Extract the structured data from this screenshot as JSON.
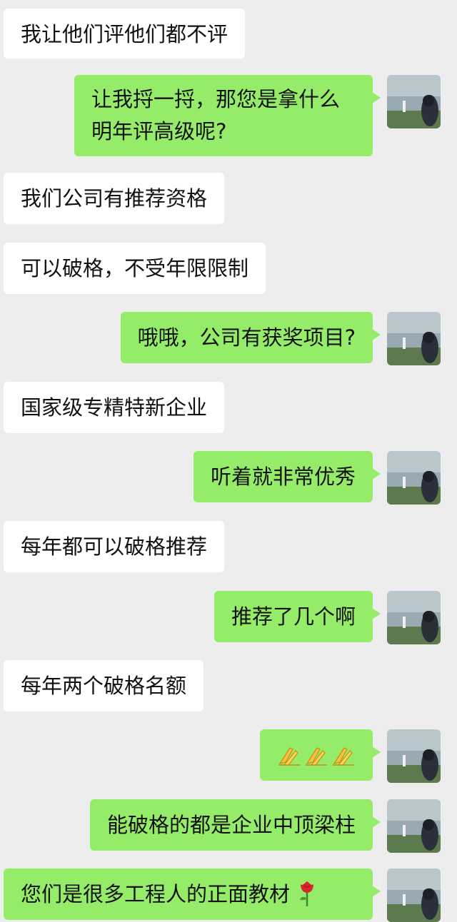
{
  "conversation": {
    "messages": [
      {
        "side": "in",
        "text": "我让他们评他们都不评"
      },
      {
        "side": "out",
        "text": "让我捋一捋，那您是拿什么明年评高级呢?"
      },
      {
        "side": "in",
        "text": "我们公司有推荐资格"
      },
      {
        "side": "in",
        "text": "可以破格，不受年限限制"
      },
      {
        "side": "out",
        "text": "哦哦，公司有获奖项目?"
      },
      {
        "side": "in",
        "text": "国家级专精特新企业"
      },
      {
        "side": "out",
        "text": "听着就非常优秀"
      },
      {
        "side": "in",
        "text": "每年都可以破格推荐"
      },
      {
        "side": "out",
        "text": "推荐了几个啊"
      },
      {
        "side": "in",
        "text": "每年两个破格名额"
      },
      {
        "side": "out",
        "text": "",
        "emoji": [
          "clap-hands-icon",
          "clap-hands-icon",
          "clap-hands-icon"
        ]
      },
      {
        "side": "out",
        "text": "能破格的都是企业中顶梁柱"
      },
      {
        "side": "out",
        "text": "您们是很多工程人的正面教材",
        "emoji": [
          "rose-icon"
        ]
      }
    ]
  },
  "colors": {
    "background": "#ededed",
    "incoming_bubble": "#ffffff",
    "outgoing_bubble": "#95ec69",
    "text": "#111111"
  }
}
